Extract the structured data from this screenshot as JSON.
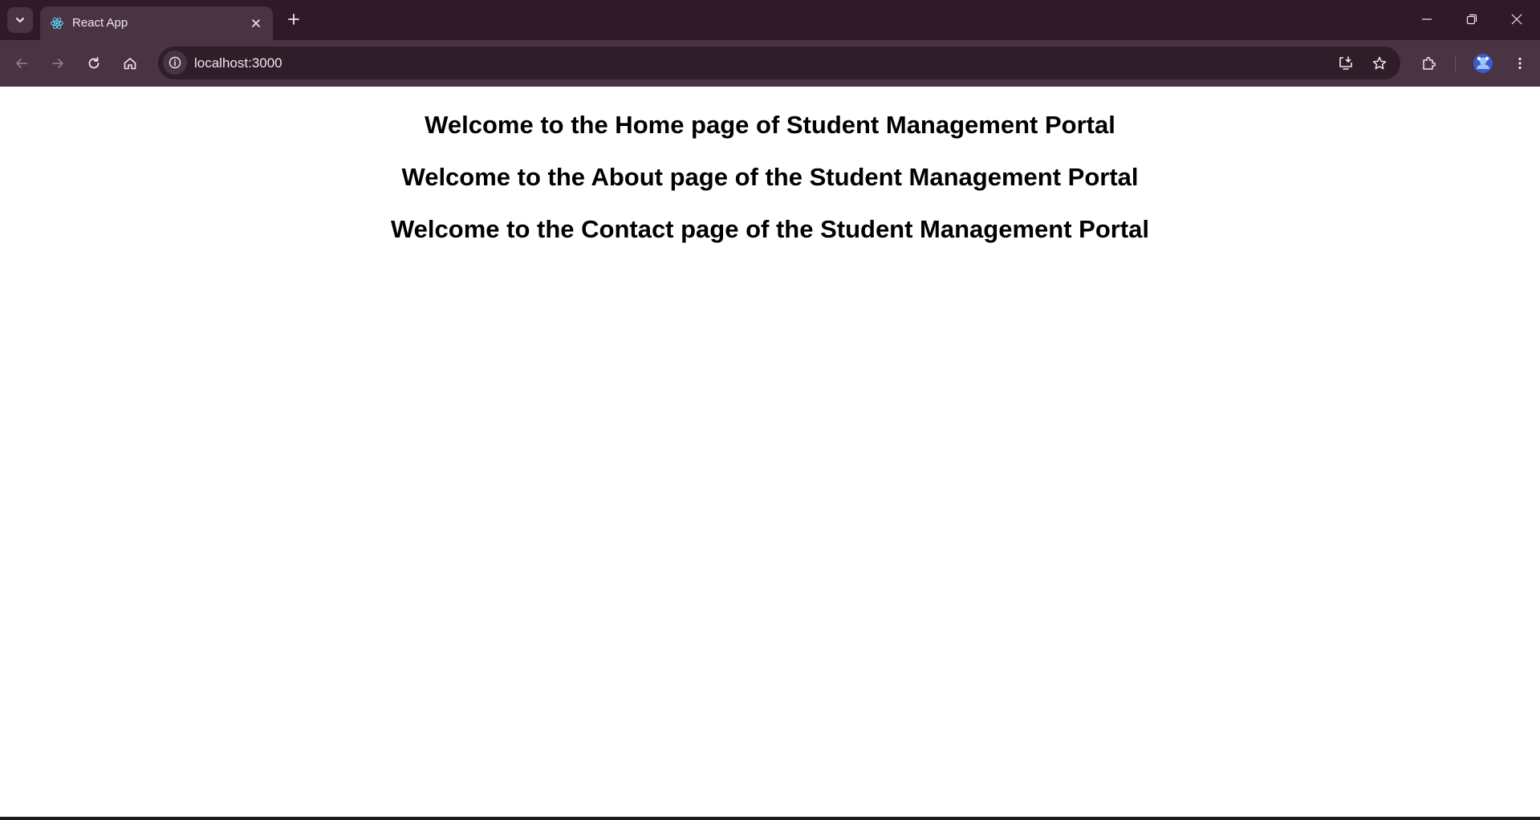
{
  "browser": {
    "tab": {
      "title": "React App",
      "favicon": "react-logo-icon"
    },
    "address_bar": {
      "url": "localhost:3000"
    },
    "colors": {
      "frame": "#301a2a",
      "toolbar": "#4a3444",
      "omnibox": "#2f1d29"
    }
  },
  "page": {
    "headings": [
      "Welcome to the Home page of Student Management Portal",
      "Welcome to the About page of the Student Management Portal",
      "Welcome to the Contact page of the Student Management Portal"
    ]
  }
}
